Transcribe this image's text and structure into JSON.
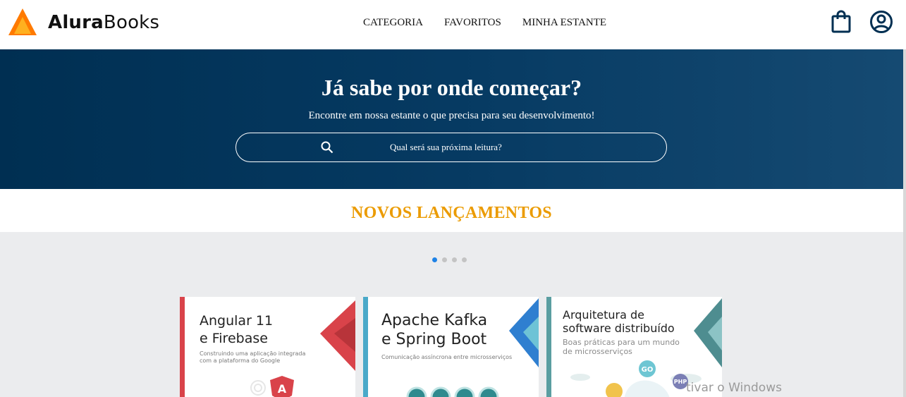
{
  "header": {
    "logo": {
      "brand_bold": "Alura",
      "brand_regular": "Books"
    },
    "nav": [
      {
        "label": "CATEGORIA"
      },
      {
        "label": "FAVORITOS"
      },
      {
        "label": "MINHA ESTANTE"
      }
    ],
    "icons": {
      "bag": "shopping-bag-icon",
      "user": "user-circle-icon"
    }
  },
  "hero": {
    "title": "Já sabe por onde começar?",
    "subtitle": "Encontre em nossa estante o que precisa para seu desenvolvimento!",
    "search": {
      "placeholder": "Qual será sua próxima leitura?",
      "value": "",
      "icon": "search-icon"
    }
  },
  "section": {
    "title": "NOVOS LANÇAMENTOS"
  },
  "carousel": {
    "pages": 4,
    "active_page": 1
  },
  "books": [
    {
      "title_line1": "Angular 11",
      "title_line2": "e Firebase",
      "subtitle_line1": "Construindo uma aplicação integrada",
      "subtitle_line2": "com a plataforma do Google",
      "accent": "#d9434a"
    },
    {
      "title_line1": "Apache Kafka",
      "title_line2": "e Spring Boot",
      "subtitle_line1": "Comunicação assíncrona entre microsserviços",
      "subtitle_line2": "",
      "accent": "#4aa9c9"
    },
    {
      "title_line1": "Arquitetura de",
      "title_line2": "software distribuído",
      "subtitle_line1": "Boas práticas para um mundo",
      "subtitle_line2": "de microsserviços",
      "accent": "#5a9ea1"
    }
  ],
  "system": {
    "watermark": "tivar o Windows"
  },
  "colors": {
    "hero_bg": "#002f52",
    "section_title": "#eb9b00",
    "dot_active": "#1e82e6",
    "logo_orange": "#ff8a00"
  }
}
